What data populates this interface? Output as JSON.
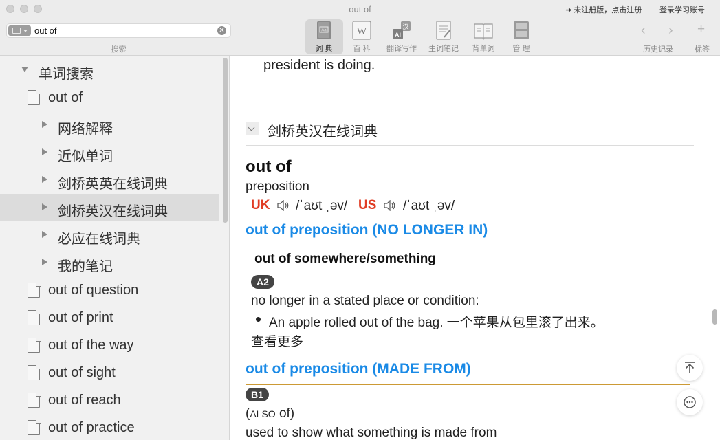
{
  "window": {
    "title": "out of",
    "register_link": "➜ 未注册版，点击注册",
    "login_link": "登录学习账号"
  },
  "search": {
    "value": "out of",
    "placeholder": "",
    "caption": "搜索"
  },
  "toolbar": {
    "tools": [
      {
        "label": "词 典",
        "icon": "dictionary-icon"
      },
      {
        "label": "百 科",
        "icon": "wikipedia-icon"
      },
      {
        "label": "翻译写作",
        "icon": "translate-icon"
      },
      {
        "label": "生词笔记",
        "icon": "notes-icon"
      },
      {
        "label": "背单词",
        "icon": "flashcard-book-icon"
      },
      {
        "label": "管 理",
        "icon": "manage-icon"
      }
    ],
    "history_label": "历史记录",
    "bookmark_label": "标签",
    "back_glyph": "‹",
    "forward_glyph": "›",
    "add_glyph": "+"
  },
  "sidebar": {
    "section": "单词搜索",
    "current_word": "out of",
    "sections": [
      "网络解释",
      "近似单词",
      "剑桥英英在线词典",
      "剑桥英汉在线词典",
      "必应在线词典",
      "我的笔记"
    ],
    "selected_section": 3,
    "related_words": [
      "out of question",
      "out of print",
      "out of the way",
      "out of sight",
      "out of reach",
      "out of practice"
    ]
  },
  "content": {
    "prev_text": "president is doing.",
    "dict_name": "剑桥英汉在线词典",
    "headword": "out of",
    "pos": "preposition",
    "uk_label": "UK",
    "uk_ipa": "/ˈaʊt ˌəv/",
    "us_label": "US",
    "us_ipa": "/ˈaʊt ˌəv/",
    "sense1_heading": "out of preposition (NO LONGER IN)",
    "guideword": "out of somewhere/something",
    "level1": "A2",
    "def1": "no longer in a stated place or condition:",
    "example1": "An apple rolled out of the bag. 一个苹果从包里滚了出来。",
    "more": "查看更多",
    "sense2_heading": "out of preposition (MADE FROM)",
    "level2": "B1",
    "grammar_open": "(",
    "grammar_also": "ALSO",
    "grammar_rest": " of)",
    "def2": "used to show what something is made from"
  },
  "colors": {
    "accent_blue": "#1a8ae6",
    "region_red": "#e03c24",
    "gold_rule": "#cc9a35",
    "sidebar_bg": "#f1f1f1",
    "toolbar_bg": "#ececec"
  }
}
